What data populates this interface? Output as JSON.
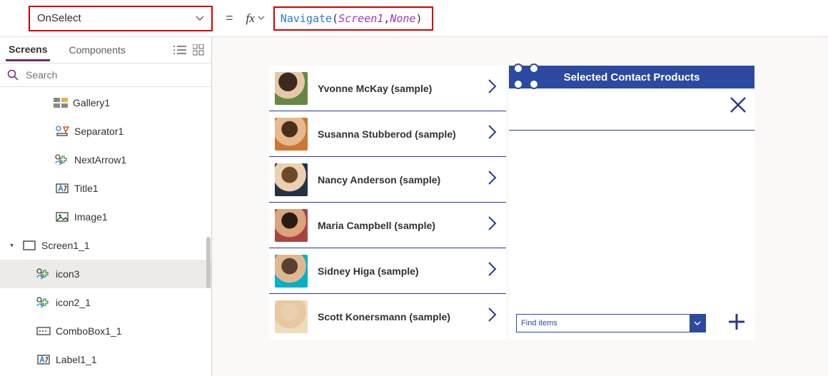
{
  "formula_bar": {
    "property": "OnSelect",
    "equals": "=",
    "fx_label": "fx",
    "tokens": {
      "func": "Navigate",
      "open": "( ",
      "arg1": "Screen1",
      "comma": ", ",
      "arg2": "None",
      "close": " )"
    }
  },
  "left_panel": {
    "tabs": {
      "screens": "Screens",
      "components": "Components"
    },
    "search_placeholder": "Search",
    "tree": {
      "gallery1": "Gallery1",
      "separator1": "Separator1",
      "nextarrow1": "NextArrow1",
      "title1": "Title1",
      "image1": "Image1",
      "screen1_1": "Screen1_1",
      "icon3": "icon3",
      "icon2_1": "icon2_1",
      "combobox1_1": "ComboBox1_1",
      "label1_1": "Label1_1"
    }
  },
  "canvas": {
    "contacts": [
      "Yvonne McKay (sample)",
      "Susanna Stubberod (sample)",
      "Nancy Anderson (sample)",
      "Maria Campbell (sample)",
      "Sidney Higa (sample)",
      "Scott Konersmann (sample)"
    ],
    "detail_header": "Selected Contact Products",
    "find_items_placeholder": "Find items"
  }
}
